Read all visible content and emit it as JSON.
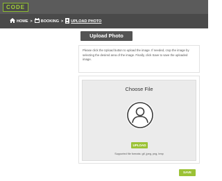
{
  "app": {
    "logo_text": "CODE"
  },
  "breadcrumb": {
    "home_label": "HOME",
    "booking_label": "BOOKING",
    "current_label": "UPLOAD PHOTO",
    "separator": ">"
  },
  "page": {
    "title": "Upload Photo",
    "instructions": "Please click the Upload button to upload the image. If needed, crop the image by selecting the desired area of the image. Finally, click Save to save the uploaded image."
  },
  "uploader": {
    "heading": "Choose File",
    "upload_label": "UPLOAD",
    "supported_formats": "Supported file formats: gif, jpeg, png, bmp",
    "avatar_icon": "user-silhouette-icon"
  },
  "actions": {
    "save_label": "SAVE"
  },
  "colors": {
    "accent": "#9bc236",
    "topbar": "#5b5b5b",
    "crumbbar": "#4a4a4a",
    "title_bg": "#545454",
    "panel_bg": "#ebebeb"
  }
}
